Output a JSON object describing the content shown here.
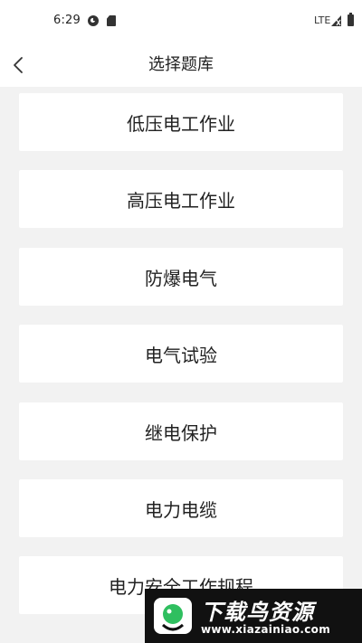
{
  "status_bar": {
    "time": "6:29",
    "network": "LTE"
  },
  "header": {
    "title": "选择题库"
  },
  "categories": [
    {
      "label": "低压电工作业"
    },
    {
      "label": "高压电工作业"
    },
    {
      "label": "防爆电气"
    },
    {
      "label": "电气试验"
    },
    {
      "label": "继电保护"
    },
    {
      "label": "电力电缆"
    },
    {
      "label": "电力安全工作规程"
    }
  ],
  "watermark": {
    "title": "下载鸟资源",
    "url": "www.xiazainiao.com"
  },
  "colors": {
    "background": "#f2f2f2",
    "card": "#ffffff",
    "text": "#222222",
    "watermark_bg": "#111111",
    "watermark_accent": "#2fbf5f"
  }
}
